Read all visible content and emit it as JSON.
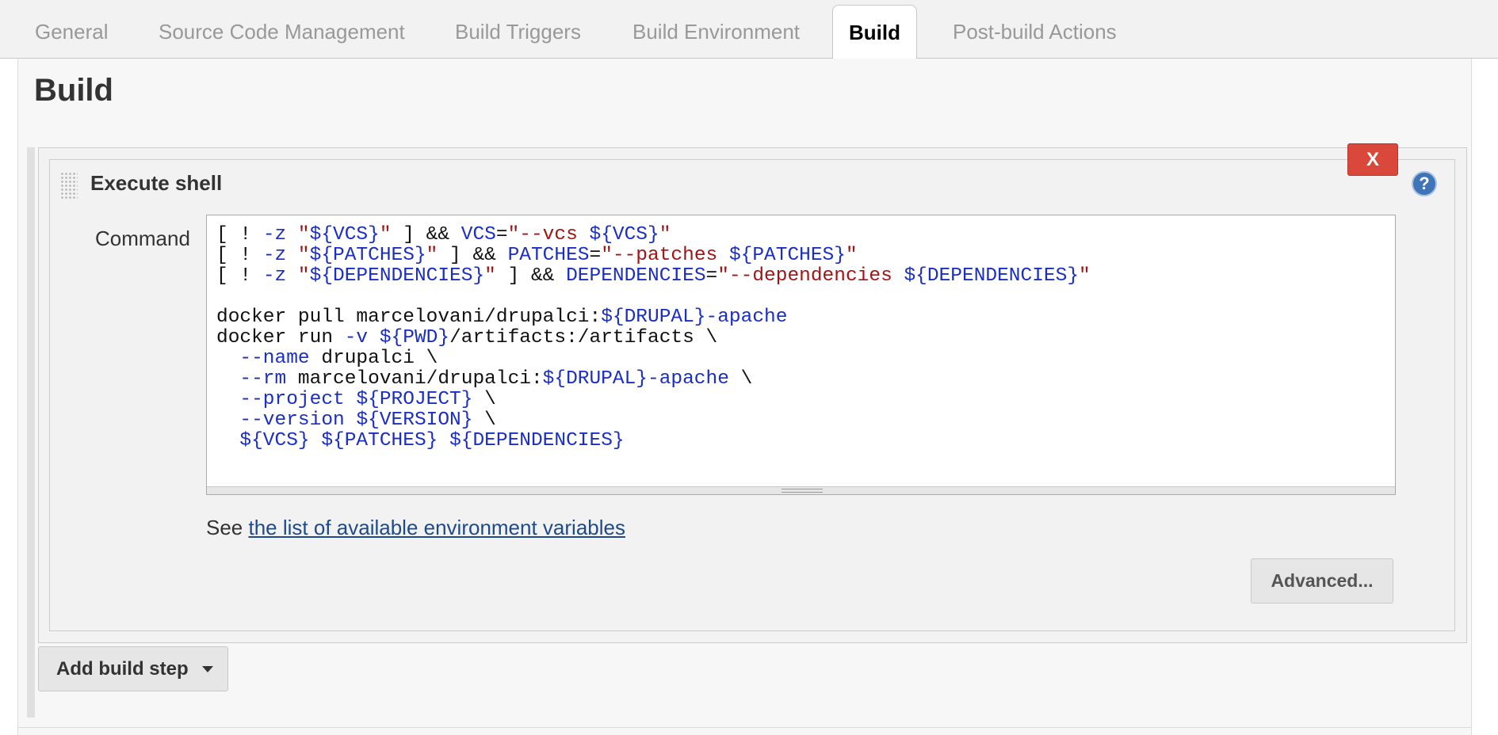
{
  "tabs": [
    {
      "label": "General"
    },
    {
      "label": "Source Code Management"
    },
    {
      "label": "Build Triggers"
    },
    {
      "label": "Build Environment"
    },
    {
      "label": "Build",
      "active": true
    },
    {
      "label": "Post-build Actions"
    }
  ],
  "section": {
    "title": "Build"
  },
  "step": {
    "title": "Execute shell",
    "delete_label": "X",
    "help_icon": "help-icon",
    "command_label": "Command",
    "command_lines": [
      "[ ! -z \"${VCS}\" ] && VCS=\"--vcs ${VCS}\"",
      "[ ! -z \"${PATCHES}\" ] && PATCHES=\"--patches ${PATCHES}\"",
      "[ ! -z \"${DEPENDENCIES}\" ] && DEPENDENCIES=\"--dependencies ${DEPENDENCIES}\"",
      "",
      "docker pull marcelovani/drupalci:${DRUPAL}-apache",
      "docker run -v ${PWD}/artifacts:/artifacts \\",
      "  --name drupalci \\",
      "  --rm marcelovani/drupalci:${DRUPAL}-apache \\",
      "  --project ${PROJECT} \\",
      "  --version ${VERSION} \\",
      "  ${VCS} ${PATCHES} ${DEPENDENCIES}"
    ],
    "see_prefix": "See ",
    "env_vars_link": "the list of available environment variables",
    "advanced_label": "Advanced..."
  },
  "add_build_step_label": "Add build step",
  "colors": {
    "keyword": "#1b2ec4",
    "string": "#a11515",
    "delete_button": "#d9483b",
    "link": "#1f4a8a"
  }
}
